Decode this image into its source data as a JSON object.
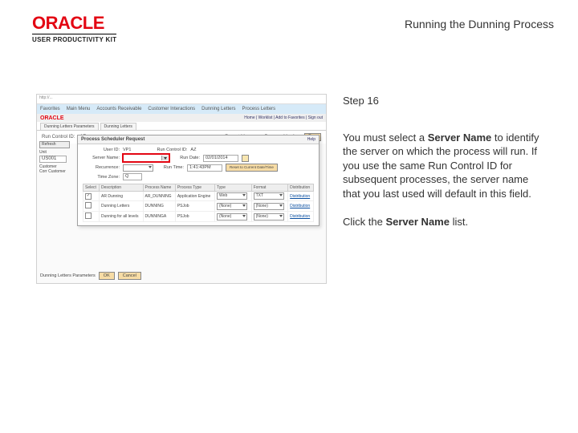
{
  "header": {
    "logo_main": "ORACLE",
    "logo_sub": "USER PRODUCTIVITY KIT",
    "page_title": "Running the Dunning Process"
  },
  "text_panel": {
    "step_label": "Step 16",
    "para1_pre": "You must select a ",
    "para1_bold": "Server Name",
    "para1_post": " to identify the server on which the process will run. If you use the same Run Control ID for subsequent processes, the server name that you last used will default in this field.",
    "para2_pre": "Click the ",
    "para2_bold": "Server Name",
    "para2_post": " list."
  },
  "mock": {
    "address": "http://...",
    "menu_items": [
      "Favorites",
      "Main Menu",
      "Accounts Receivable",
      "Customer Interactions",
      "Dunning Letters",
      "Process Letters"
    ],
    "oracle_bar_links": "Home | Worklist | Add to Favorites | Sign out",
    "tabs": [
      "Dunning Letters Parameters",
      "Dunning Letters"
    ],
    "toprow": {
      "run_control_label": "Run Control ID:",
      "run_control_value": "AZ",
      "report_mgr": "Report Manager",
      "proc_mon": "Process Monitor",
      "run_btn": "Run"
    },
    "sidebar": [
      "Refresh",
      "Unit",
      "Customer",
      "Corr Customer"
    ],
    "unit_value": "US001",
    "dialog": {
      "title": "Process Scheduler Request",
      "help": "Help",
      "user_label": "User ID:",
      "user_value": "VP1",
      "server_label": "Server Name:",
      "recur_label": "Recurrence:",
      "tz_label": "Time Zone:",
      "tz_value": "Q",
      "rundate_label": "Run Date:",
      "rundate_value": "02/01/2014",
      "runtime_label": "Run Time:",
      "runtime_value": "1:41:43PM",
      "reset_btn": "Reset to Current Date/Time",
      "table_headers": [
        "Select",
        "Description",
        "Process Name",
        "Process Type",
        "Type",
        "Format",
        "Distribution"
      ],
      "rows": [
        {
          "select": true,
          "desc": "AR Dunning",
          "pname": "AR_DUNNING",
          "ptype": "Application Engine",
          "type": "Web",
          "format": "TXT",
          "dist": "Distribution"
        },
        {
          "select": false,
          "desc": "Dunning Letters",
          "pname": "DUNNING",
          "ptype": "PSJob",
          "type": "(None)",
          "format": "(None)",
          "dist": "Distribution"
        },
        {
          "select": false,
          "desc": "Dunning for all levels",
          "pname": "DUNNINGA",
          "ptype": "PSJob",
          "type": "(None)",
          "format": "(None)",
          "dist": "Distribution"
        }
      ]
    },
    "footer": {
      "label": "Dunning Letters Parameters",
      "ok": "OK",
      "cancel": "Cancel"
    }
  }
}
